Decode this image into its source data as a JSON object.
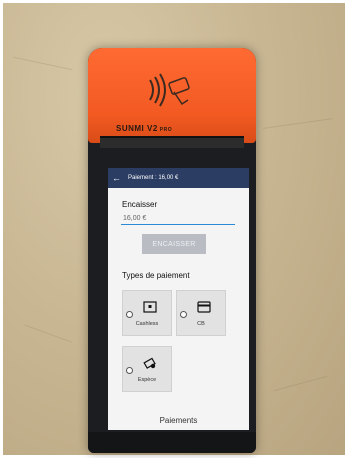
{
  "device": {
    "brand": "SUNMI V2",
    "model_suffix": "PRO"
  },
  "screen": {
    "appbar": {
      "title": "Paiement : 16,00 €"
    },
    "encaisser_label": "Encaisser",
    "amount_input": {
      "value": "16,00 €"
    },
    "encaisser_button": "ENCAISSER",
    "payment_types_label": "Types de paiement",
    "payment_options": [
      {
        "label": "Cashless",
        "icon": "cashless-card-icon",
        "selected": false
      },
      {
        "label": "CB",
        "icon": "credit-card-icon",
        "selected": false
      },
      {
        "label": "Espèce",
        "icon": "cash-icon",
        "selected": false
      }
    ],
    "footer_title": "Paiements"
  },
  "colors": {
    "appbar": "#2b3d63",
    "device_cap": "#f25a22",
    "input_underline": "#2a8ad8",
    "button_disabled": "#b9bdc3"
  }
}
